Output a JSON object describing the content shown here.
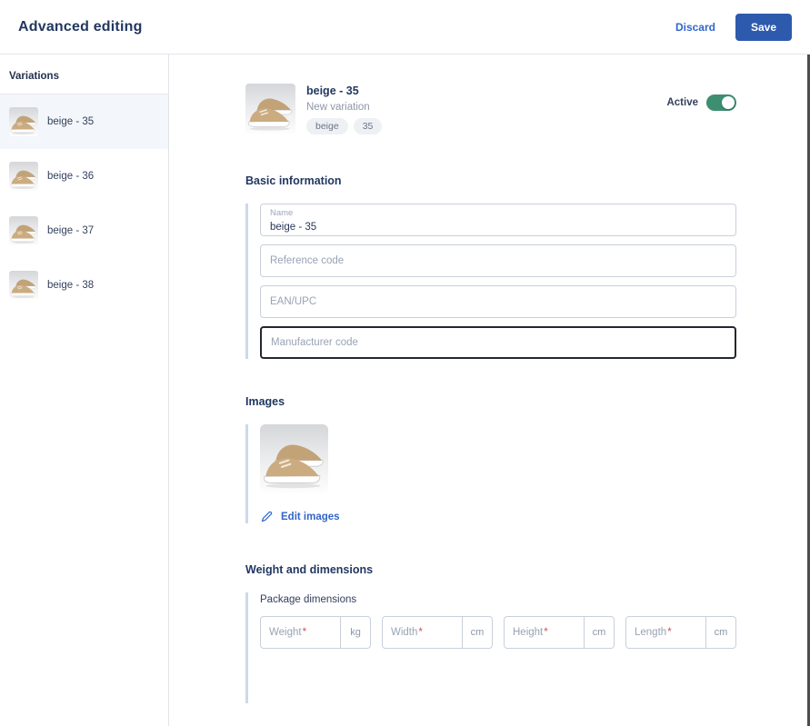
{
  "topbar": {
    "title": "Advanced editing",
    "discard_label": "Discard",
    "save_label": "Save"
  },
  "sidebar": {
    "header": "Variations",
    "items": [
      {
        "label": "beige - 35",
        "selected": true
      },
      {
        "label": "beige - 36",
        "selected": false
      },
      {
        "label": "beige - 37",
        "selected": false
      },
      {
        "label": "beige - 38",
        "selected": false
      }
    ]
  },
  "product_header": {
    "title": "beige - 35",
    "subtitle": "New variation",
    "tags": [
      "beige",
      "35"
    ],
    "active_label": "Active",
    "active_state": "on"
  },
  "basic_info": {
    "heading": "Basic information",
    "name_field": {
      "label": "Name",
      "value": "beige - 35"
    },
    "reference_field": {
      "placeholder": "Reference code"
    },
    "ean_field": {
      "placeholder": "EAN/UPC"
    },
    "manufacturer_field": {
      "placeholder": "Manufacturer code"
    }
  },
  "images_section": {
    "heading": "Images",
    "edit_images_label": "Edit images",
    "icon": "pencil-icon"
  },
  "weight_dimensions": {
    "heading": "Weight and dimensions",
    "group_label": "Package dimensions",
    "required_mark": "*",
    "fields": [
      {
        "label": "Weight",
        "unit": "kg"
      },
      {
        "label": "Width",
        "unit": "cm"
      },
      {
        "label": "Height",
        "unit": "cm"
      },
      {
        "label": "Length",
        "unit": "cm"
      }
    ]
  },
  "colors": {
    "primary_blue": "#2e5aae",
    "link_blue": "#3166c9",
    "toggle_green": "#3e8e72",
    "required_red": "#d2504e",
    "heading_navy": "#223760",
    "accent_bar": "#ccd9ec",
    "selected_item_bg": "#f3f6fa"
  }
}
